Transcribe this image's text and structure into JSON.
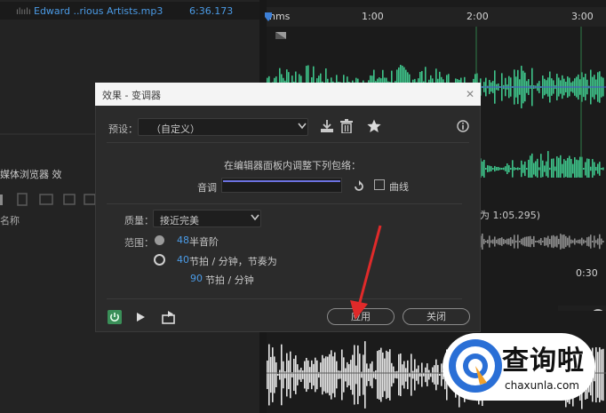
{
  "files": {
    "name": "Edward ..rious Artists.mp3",
    "duration": "6:36.173",
    "wave_glyph": "ılıılı"
  },
  "left_panel": {
    "tabs": "媒体浏览器    效",
    "column": "名称"
  },
  "ruler": {
    "unit": "hms",
    "ticks": [
      "1:00",
      "2:00",
      "3:00"
    ]
  },
  "selection_info": "为 1:05.295)",
  "ruler2": {
    "tick": "0:30"
  },
  "dialog": {
    "title": "效果 - 变调器",
    "close": "✕",
    "preset_label": "预设：",
    "preset_value": "（自定义）",
    "instruction": "在编辑器面板内调整下列包络：",
    "pitch_label": "音调",
    "curve_label": "曲线",
    "quality_label": "质量：",
    "quality_value": "接近完美",
    "range_label": "范围：",
    "range_semitones_value": "48",
    "range_semitones_unit": "半音阶",
    "range_bpm_value": "40",
    "range_bpm_unit": "节拍 / 分钟，节奏为",
    "tempo_value": "90",
    "tempo_unit": "节拍 / 分钟",
    "apply_label": "应用",
    "close_label": "关闭"
  },
  "colors": {
    "waveform": "#3ec48a",
    "accent_blue": "#4b9be6",
    "power_green": "#3a8f58",
    "annotation_red": "#e02a2a"
  },
  "watermark": {
    "cn": "查询啦",
    "en": "chaxunla.com"
  }
}
